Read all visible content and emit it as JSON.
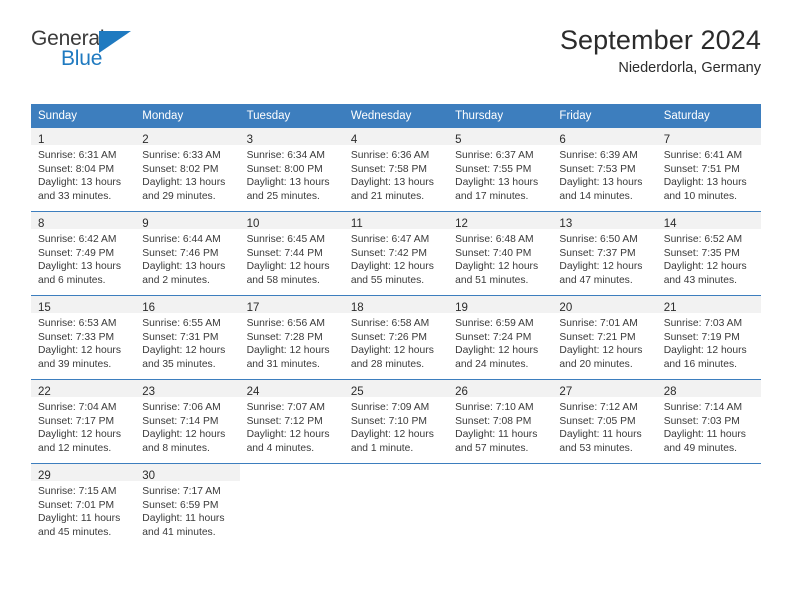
{
  "brand": {
    "name_part1": "General",
    "name_part2": "Blue",
    "triangle_color": "#1f7ac0"
  },
  "header": {
    "title": "September 2024",
    "subtitle": "Niederdorla, Germany"
  },
  "colors": {
    "header_blue": "#3d7ebe",
    "daynum_band": "#f2f2f2",
    "text": "#2b2b2b"
  },
  "weekdays": [
    "Sunday",
    "Monday",
    "Tuesday",
    "Wednesday",
    "Thursday",
    "Friday",
    "Saturday"
  ],
  "weeks": [
    [
      {
        "day": "1",
        "sunrise": "Sunrise: 6:31 AM",
        "sunset": "Sunset: 8:04 PM",
        "daylight": "Daylight: 13 hours and 33 minutes."
      },
      {
        "day": "2",
        "sunrise": "Sunrise: 6:33 AM",
        "sunset": "Sunset: 8:02 PM",
        "daylight": "Daylight: 13 hours and 29 minutes."
      },
      {
        "day": "3",
        "sunrise": "Sunrise: 6:34 AM",
        "sunset": "Sunset: 8:00 PM",
        "daylight": "Daylight: 13 hours and 25 minutes."
      },
      {
        "day": "4",
        "sunrise": "Sunrise: 6:36 AM",
        "sunset": "Sunset: 7:58 PM",
        "daylight": "Daylight: 13 hours and 21 minutes."
      },
      {
        "day": "5",
        "sunrise": "Sunrise: 6:37 AM",
        "sunset": "Sunset: 7:55 PM",
        "daylight": "Daylight: 13 hours and 17 minutes."
      },
      {
        "day": "6",
        "sunrise": "Sunrise: 6:39 AM",
        "sunset": "Sunset: 7:53 PM",
        "daylight": "Daylight: 13 hours and 14 minutes."
      },
      {
        "day": "7",
        "sunrise": "Sunrise: 6:41 AM",
        "sunset": "Sunset: 7:51 PM",
        "daylight": "Daylight: 13 hours and 10 minutes."
      }
    ],
    [
      {
        "day": "8",
        "sunrise": "Sunrise: 6:42 AM",
        "sunset": "Sunset: 7:49 PM",
        "daylight": "Daylight: 13 hours and 6 minutes."
      },
      {
        "day": "9",
        "sunrise": "Sunrise: 6:44 AM",
        "sunset": "Sunset: 7:46 PM",
        "daylight": "Daylight: 13 hours and 2 minutes."
      },
      {
        "day": "10",
        "sunrise": "Sunrise: 6:45 AM",
        "sunset": "Sunset: 7:44 PM",
        "daylight": "Daylight: 12 hours and 58 minutes."
      },
      {
        "day": "11",
        "sunrise": "Sunrise: 6:47 AM",
        "sunset": "Sunset: 7:42 PM",
        "daylight": "Daylight: 12 hours and 55 minutes."
      },
      {
        "day": "12",
        "sunrise": "Sunrise: 6:48 AM",
        "sunset": "Sunset: 7:40 PM",
        "daylight": "Daylight: 12 hours and 51 minutes."
      },
      {
        "day": "13",
        "sunrise": "Sunrise: 6:50 AM",
        "sunset": "Sunset: 7:37 PM",
        "daylight": "Daylight: 12 hours and 47 minutes."
      },
      {
        "day": "14",
        "sunrise": "Sunrise: 6:52 AM",
        "sunset": "Sunset: 7:35 PM",
        "daylight": "Daylight: 12 hours and 43 minutes."
      }
    ],
    [
      {
        "day": "15",
        "sunrise": "Sunrise: 6:53 AM",
        "sunset": "Sunset: 7:33 PM",
        "daylight": "Daylight: 12 hours and 39 minutes."
      },
      {
        "day": "16",
        "sunrise": "Sunrise: 6:55 AM",
        "sunset": "Sunset: 7:31 PM",
        "daylight": "Daylight: 12 hours and 35 minutes."
      },
      {
        "day": "17",
        "sunrise": "Sunrise: 6:56 AM",
        "sunset": "Sunset: 7:28 PM",
        "daylight": "Daylight: 12 hours and 31 minutes."
      },
      {
        "day": "18",
        "sunrise": "Sunrise: 6:58 AM",
        "sunset": "Sunset: 7:26 PM",
        "daylight": "Daylight: 12 hours and 28 minutes."
      },
      {
        "day": "19",
        "sunrise": "Sunrise: 6:59 AM",
        "sunset": "Sunset: 7:24 PM",
        "daylight": "Daylight: 12 hours and 24 minutes."
      },
      {
        "day": "20",
        "sunrise": "Sunrise: 7:01 AM",
        "sunset": "Sunset: 7:21 PM",
        "daylight": "Daylight: 12 hours and 20 minutes."
      },
      {
        "day": "21",
        "sunrise": "Sunrise: 7:03 AM",
        "sunset": "Sunset: 7:19 PM",
        "daylight": "Daylight: 12 hours and 16 minutes."
      }
    ],
    [
      {
        "day": "22",
        "sunrise": "Sunrise: 7:04 AM",
        "sunset": "Sunset: 7:17 PM",
        "daylight": "Daylight: 12 hours and 12 minutes."
      },
      {
        "day": "23",
        "sunrise": "Sunrise: 7:06 AM",
        "sunset": "Sunset: 7:14 PM",
        "daylight": "Daylight: 12 hours and 8 minutes."
      },
      {
        "day": "24",
        "sunrise": "Sunrise: 7:07 AM",
        "sunset": "Sunset: 7:12 PM",
        "daylight": "Daylight: 12 hours and 4 minutes."
      },
      {
        "day": "25",
        "sunrise": "Sunrise: 7:09 AM",
        "sunset": "Sunset: 7:10 PM",
        "daylight": "Daylight: 12 hours and 1 minute."
      },
      {
        "day": "26",
        "sunrise": "Sunrise: 7:10 AM",
        "sunset": "Sunset: 7:08 PM",
        "daylight": "Daylight: 11 hours and 57 minutes."
      },
      {
        "day": "27",
        "sunrise": "Sunrise: 7:12 AM",
        "sunset": "Sunset: 7:05 PM",
        "daylight": "Daylight: 11 hours and 53 minutes."
      },
      {
        "day": "28",
        "sunrise": "Sunrise: 7:14 AM",
        "sunset": "Sunset: 7:03 PM",
        "daylight": "Daylight: 11 hours and 49 minutes."
      }
    ],
    [
      {
        "day": "29",
        "sunrise": "Sunrise: 7:15 AM",
        "sunset": "Sunset: 7:01 PM",
        "daylight": "Daylight: 11 hours and 45 minutes."
      },
      {
        "day": "30",
        "sunrise": "Sunrise: 7:17 AM",
        "sunset": "Sunset: 6:59 PM",
        "daylight": "Daylight: 11 hours and 41 minutes."
      },
      {
        "day": "",
        "sunrise": "",
        "sunset": "",
        "daylight": ""
      },
      {
        "day": "",
        "sunrise": "",
        "sunset": "",
        "daylight": ""
      },
      {
        "day": "",
        "sunrise": "",
        "sunset": "",
        "daylight": ""
      },
      {
        "day": "",
        "sunrise": "",
        "sunset": "",
        "daylight": ""
      },
      {
        "day": "",
        "sunrise": "",
        "sunset": "",
        "daylight": ""
      }
    ]
  ]
}
